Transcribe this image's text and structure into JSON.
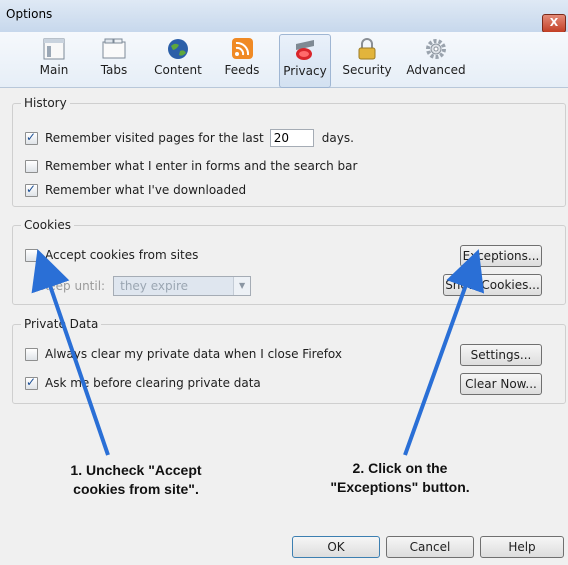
{
  "window": {
    "title": "Options",
    "close_label": "X"
  },
  "toolbar": {
    "panes": [
      {
        "label": "Main",
        "icon": "main-window-icon"
      },
      {
        "label": "Tabs",
        "icon": "tabs-icon"
      },
      {
        "label": "Content",
        "icon": "globe-icon"
      },
      {
        "label": "Feeds",
        "icon": "rss-feed-icon"
      },
      {
        "label": "Privacy",
        "icon": "privacy-mask-icon",
        "selected": true
      },
      {
        "label": "Security",
        "icon": "padlock-icon"
      },
      {
        "label": "Advanced",
        "icon": "gear-icon"
      }
    ]
  },
  "history": {
    "legend": "History",
    "remember_visited": {
      "label_before": "Remember visited pages for the last",
      "days_value": "20",
      "label_after": "days.",
      "checked": true
    },
    "remember_forms": {
      "label": "Remember what I enter in forms and the search bar",
      "checked": false
    },
    "remember_downloads": {
      "label": "Remember what I've downloaded",
      "checked": true
    }
  },
  "cookies": {
    "legend": "Cookies",
    "accept": {
      "label": "Accept cookies from sites",
      "checked": false
    },
    "keep_until": {
      "label": "Keep until:",
      "value": "they expire"
    },
    "exceptions_button": "Exceptions...",
    "show_cookies_button": "Show Cookies..."
  },
  "private_data": {
    "legend": "Private Data",
    "always_clear": {
      "label": "Always clear my private data when I close Firefox",
      "checked": false
    },
    "ask_before": {
      "label": "Ask me before clearing private data",
      "checked": true
    },
    "settings_button": "Settings...",
    "clear_now_button": "Clear Now..."
  },
  "annotations": {
    "step1": [
      "1. Uncheck \"Accept",
      "cookies from site\"."
    ],
    "step2": [
      "2. Click on the",
      "\"Exceptions\" button."
    ]
  },
  "footer": {
    "ok": "OK",
    "cancel": "Cancel",
    "help": "Help"
  },
  "colors": {
    "arrow": "#2a6fd6",
    "titlebar": "#c7d8ec",
    "close": "#c23f25"
  }
}
